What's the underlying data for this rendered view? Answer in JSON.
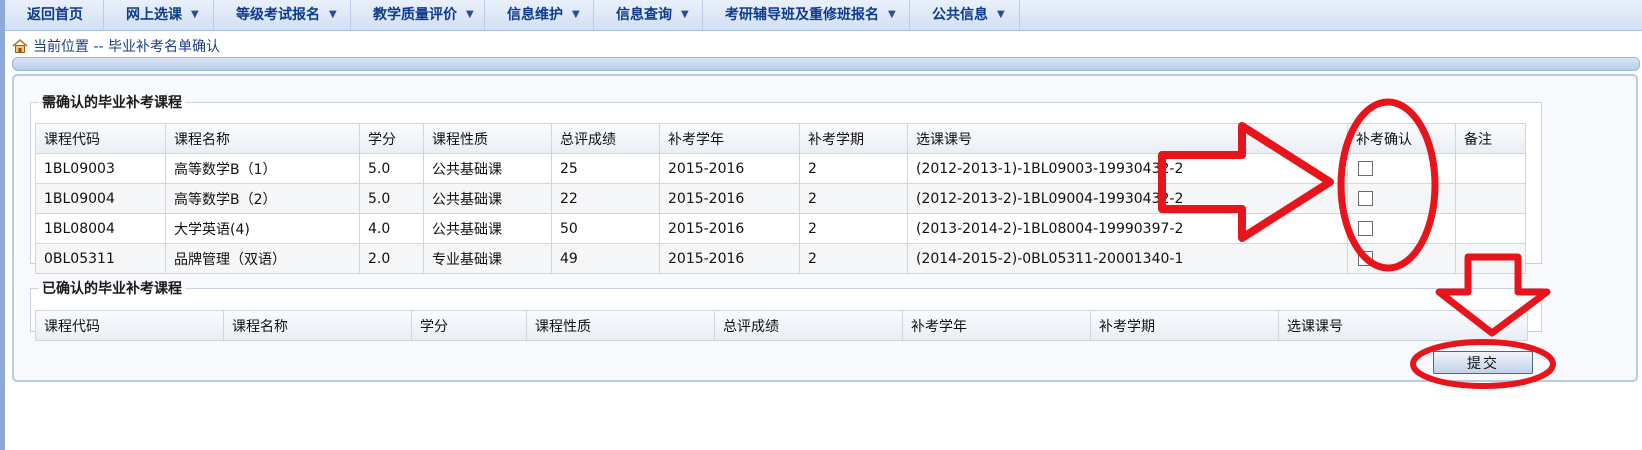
{
  "nav": {
    "items": [
      {
        "label": "返回首页",
        "dropdown": false
      },
      {
        "label": "网上选课",
        "dropdown": true
      },
      {
        "label": "等级考试报名",
        "dropdown": true
      },
      {
        "label": "教学质量评价",
        "dropdown": true
      },
      {
        "label": "信息维护",
        "dropdown": true
      },
      {
        "label": "信息查询",
        "dropdown": true
      },
      {
        "label": "考研辅导班及重修班报名",
        "dropdown": true
      },
      {
        "label": "公共信息",
        "dropdown": true
      }
    ]
  },
  "breadcrumb": {
    "icon": "home-icon",
    "text": "当前位置 -- 毕业补考名单确认"
  },
  "pending": {
    "legend": "需确认的毕业补考课程",
    "headers": [
      "课程代码",
      "课程名称",
      "学分",
      "课程性质",
      "总评成绩",
      "补考学年",
      "补考学期",
      "选课课号",
      "补考确认",
      "备注"
    ],
    "rows": [
      {
        "code": "1BL09003",
        "name": "高等数学B（1）",
        "credit": "5.0",
        "nature": "公共基础课",
        "score": "25",
        "year": "2015-2016",
        "term": "2",
        "course_no": "(2012-2013-1)-1BL09003-19930432-2",
        "confirmed": false,
        "remark": ""
      },
      {
        "code": "1BL09004",
        "name": "高等数学B（2）",
        "credit": "5.0",
        "nature": "公共基础课",
        "score": "22",
        "year": "2015-2016",
        "term": "2",
        "course_no": "(2012-2013-2)-1BL09004-19930432-2",
        "confirmed": false,
        "remark": ""
      },
      {
        "code": "1BL08004",
        "name": "大学英语(4)",
        "credit": "4.0",
        "nature": "公共基础课",
        "score": "50",
        "year": "2015-2016",
        "term": "2",
        "course_no": "(2013-2014-2)-1BL08004-19990397-2",
        "confirmed": false,
        "remark": ""
      },
      {
        "code": "0BL05311",
        "name": "品牌管理（双语）",
        "credit": "2.0",
        "nature": "专业基础课",
        "score": "49",
        "year": "2015-2016",
        "term": "2",
        "course_no": "(2014-2015-2)-0BL05311-20001340-1",
        "confirmed": false,
        "remark": ""
      }
    ]
  },
  "confirmed": {
    "legend": "已确认的毕业补考课程",
    "headers": [
      "课程代码",
      "课程名称",
      "学分",
      "课程性质",
      "总评成绩",
      "补考学年",
      "补考学期",
      "选课课号"
    ]
  },
  "submit_label": "提交",
  "colors": {
    "nav_text": "#0d3a8a",
    "annotation_red": "#e8141c",
    "panel_border": "#b7cae6"
  }
}
